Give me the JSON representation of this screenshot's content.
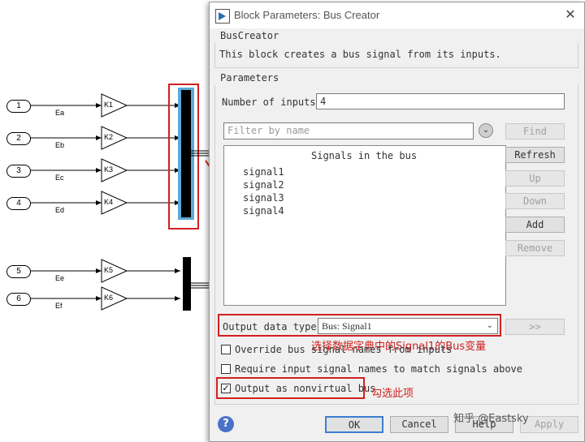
{
  "model": {
    "inports": [
      "1",
      "2",
      "3",
      "4",
      "5",
      "6"
    ],
    "signal_labels": [
      "Ea",
      "Eb",
      "Ec",
      "Ed",
      "Ee",
      "Ef"
    ],
    "gains": [
      "K1",
      "K2",
      "K3",
      "K4",
      "K5",
      "K6"
    ]
  },
  "dialog": {
    "title": "Block Parameters: Bus Creator",
    "close_glyph": "✕",
    "block_group": "BusCreator",
    "block_description": "This block creates a bus signal from its inputs.",
    "parameters_group": "Parameters",
    "num_inputs_label": "Number of inputs:",
    "num_inputs_value": "4",
    "filter_placeholder": "Filter by name",
    "signals_header": "Signals in the bus",
    "signals": [
      "signal1",
      "signal2",
      "signal3",
      "signal4"
    ],
    "buttons": {
      "find": "Find",
      "refresh": "Refresh",
      "up": "Up",
      "down": "Down",
      "add": "Add",
      "remove": "Remove",
      "more": ">>",
      "ok": "OK",
      "cancel": "Cancel",
      "help": "Help",
      "apply": "Apply"
    },
    "output_type_label": "Output data type:",
    "output_type_value": "Bus: Signal1",
    "checkboxes": [
      {
        "label": "Override bus signal names from inputs",
        "checked": false
      },
      {
        "label": "Require input signal names to match signals above",
        "checked": false
      },
      {
        "label": "Output as nonvirtual bus",
        "checked": true
      }
    ],
    "annotations": {
      "output_type_note": "选择数据字典中的Signal1的Bus变量",
      "checkbox_note": "勾选此项"
    },
    "watermark": "知乎 @Eastsky"
  },
  "colors": {
    "annotation_red": "#d22020",
    "bus_highlight": "#5aa9d6"
  }
}
